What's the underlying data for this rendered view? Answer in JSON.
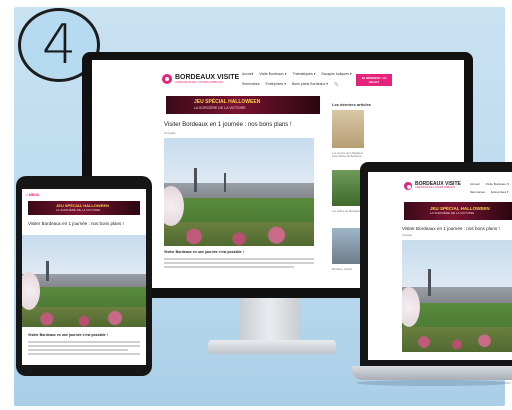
{
  "step": {
    "number": "4"
  },
  "brand": {
    "name": "BORDEAUX VISITE",
    "tagline": "CRÉATEUR DE LOISIRS URBAINS",
    "accent_color": "#e4237a"
  },
  "desktop": {
    "nav": [
      "Accueil",
      "Visite Bordeaux ▾",
      "Thématiques ▾",
      "Escapes ludiques ▾"
    ],
    "nav2": [
      "Séminaires",
      "Entreprises ▾",
      "Bons plans Bordeaux ▾",
      "🔍"
    ],
    "cta": "JE RÉSERVE / LE BILLET",
    "banner": {
      "line1": "JEU SPÉCIAL HALLOWEEN",
      "line2": "LA SORCIÈRE DE LA VICTOIRE"
    },
    "article_title": "Visiter Bordeaux en 1 journée : nos bons plans !",
    "article_meta": "Conseils",
    "section_heading": "Visiter Bordeaux en une journée c'est possible !",
    "sidebar_heading": "Les derniers articles",
    "sidebar_captions": [
      "Les secrets de la Basilique Saint-Michel de Bordeaux",
      "Les jardins de Bordeaux",
      "Bordeaux insolite"
    ]
  },
  "tablet": {
    "menu": "≡ MENU",
    "banner": {
      "line1": "JEU SPÉCIAL HALLOWEEN",
      "line2": "LA SORCIÈRE DE LA VICTOIRE"
    },
    "article_title": "Visiter Bordeaux en 1 journée : nos bons plans !",
    "section_heading": "Visiter Bordeaux en une journée c'est possible !"
  },
  "laptop": {
    "nav": [
      "Accueil",
      "Visite Bordeaux ▾"
    ],
    "nav2": [
      "Séminaires",
      "Entreprises ▾"
    ],
    "banner": {
      "line1": "JEU SPÉCIAL HALLOWEEN",
      "line2": "LA SORCIÈRE DE LA VICTOIRE"
    },
    "article_title": "Visiter Bordeaux en 1 journée : nos bons plans !",
    "article_meta": "Conseils"
  }
}
